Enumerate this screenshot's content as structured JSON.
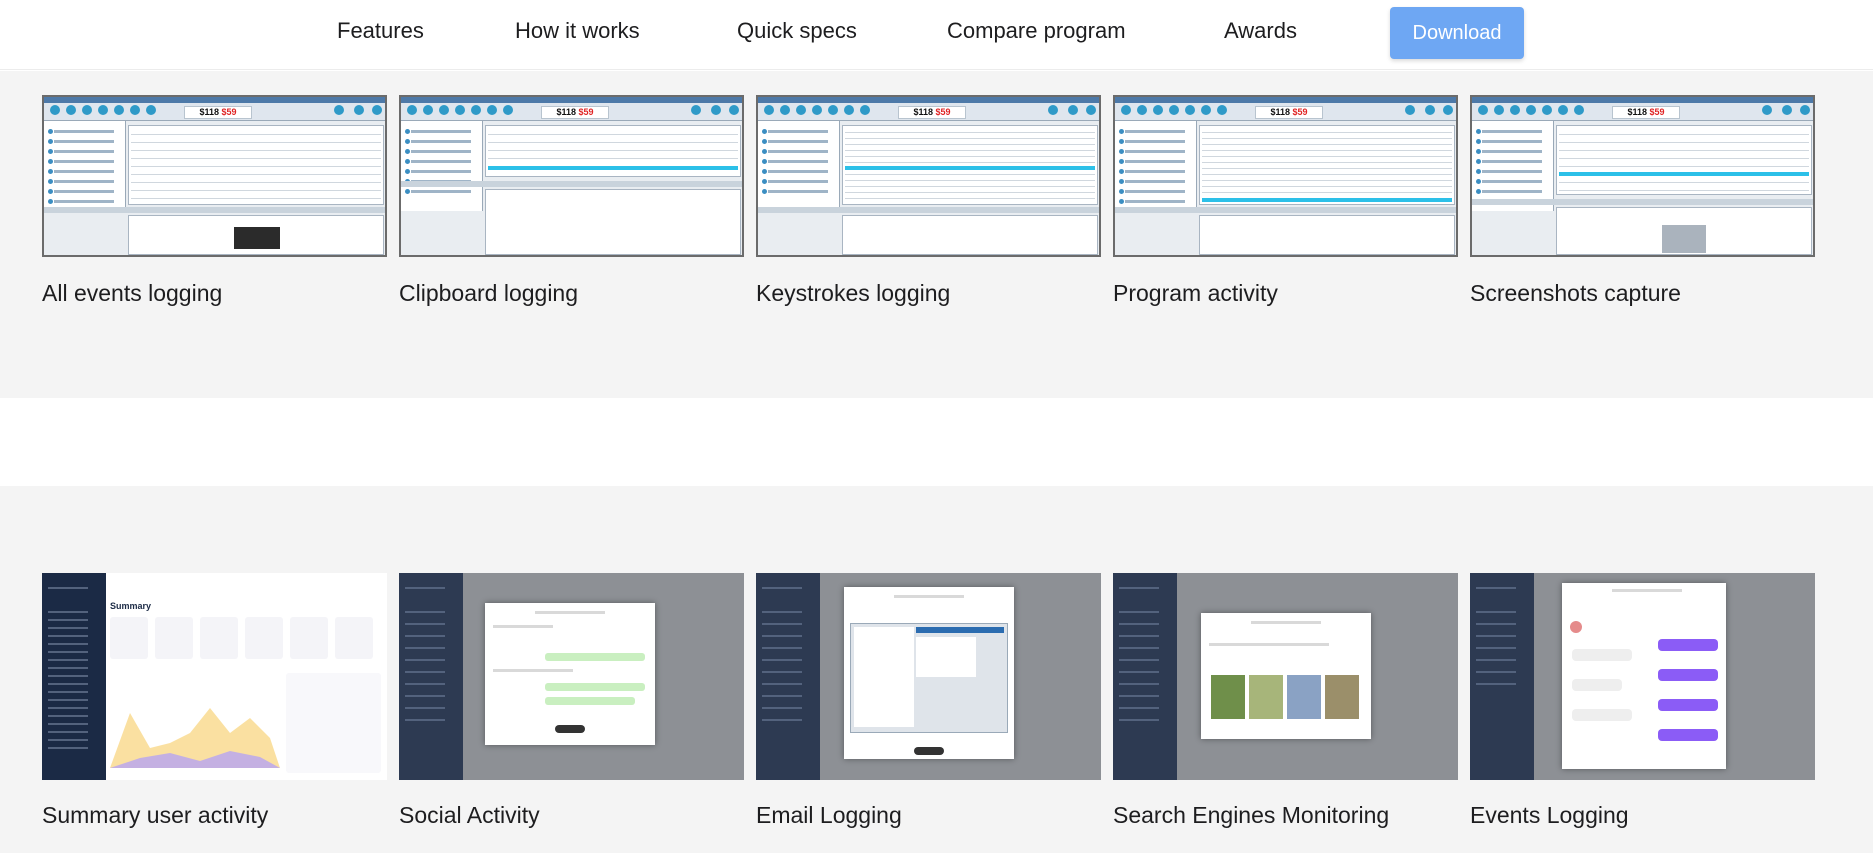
{
  "nav": {
    "items": [
      "Features",
      "How it works",
      "Quick specs",
      "Compare program",
      "Awards"
    ],
    "download_label": "Download"
  },
  "desktop_section": {
    "cards": [
      {
        "caption": "All events logging"
      },
      {
        "caption": "Clipboard logging"
      },
      {
        "caption": "Keystrokes logging"
      },
      {
        "caption": "Program activity"
      },
      {
        "caption": "Screenshots capture"
      }
    ],
    "price_text": "$118",
    "price_sale": "$59"
  },
  "cloud_section": {
    "cards": [
      {
        "caption": "Summary user activity"
      },
      {
        "caption": "Social Activity"
      },
      {
        "caption": "Email Logging"
      },
      {
        "caption": "Search Engines Monitoring"
      },
      {
        "caption": "Events Logging"
      }
    ],
    "summary_heading": "Summary"
  },
  "colors": {
    "download_bg": "#6ea7f3",
    "band_bg": "#f4f4f4",
    "sidebar_dark": "#1b2a45",
    "accent_cyan": "#2cc0e8",
    "accent_purple": "#8b5cf6"
  }
}
